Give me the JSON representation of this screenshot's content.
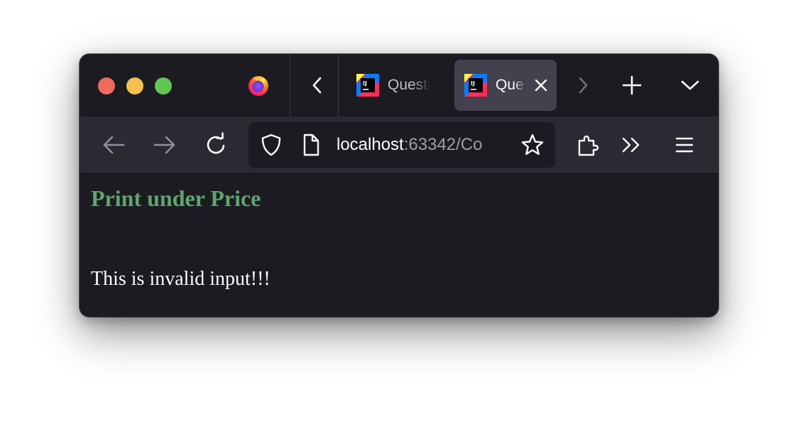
{
  "browser": {
    "tabs": [
      {
        "title": "Questi",
        "favicon": "intellij-icon",
        "active": false
      },
      {
        "title": "Que",
        "favicon": "intellij-icon",
        "active": true
      }
    ],
    "url": {
      "host": "localhost",
      "rest": ":63342/Co"
    },
    "icons": {
      "window_controls": [
        "close-dot",
        "minimize-dot",
        "zoom-dot"
      ],
      "browser_logo": "firefox-icon",
      "toolbar": [
        "back-arrow-icon",
        "forward-arrow-icon",
        "reload-icon",
        "shield-icon",
        "page-icon",
        "star-icon",
        "extensions-icon",
        "overflow-icon",
        "menu-icon"
      ]
    },
    "colors": {
      "traffic_red": "#ec6a5e",
      "traffic_yellow": "#f4bf4f",
      "traffic_green": "#61c554",
      "heading_green": "#5fa56e",
      "background": "#1c1b22",
      "toolbar": "#2b2a33"
    }
  },
  "page": {
    "heading": "Print under Price",
    "message": "This is invalid input!!!"
  }
}
